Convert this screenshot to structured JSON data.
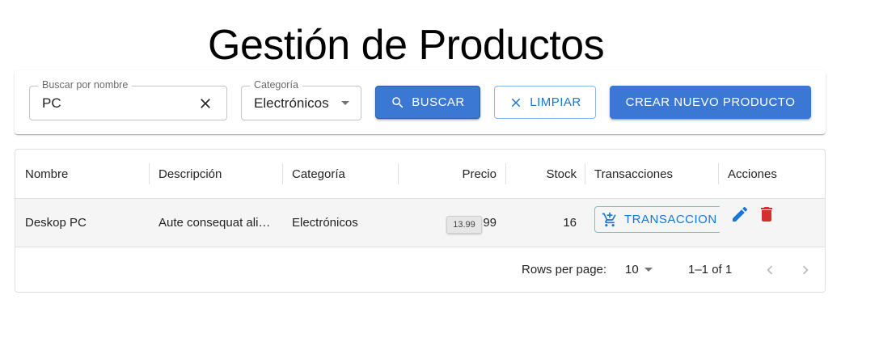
{
  "page": {
    "title": "Gestión de Productos"
  },
  "filters": {
    "search": {
      "label": "Buscar por nombre",
      "value": "PC"
    },
    "category": {
      "label": "Categoría",
      "value": "Electrónicos"
    },
    "search_button": "BUSCAR",
    "clear_button": "LIMPIAR",
    "create_button": "CREAR NUEVO PRODUCTO"
  },
  "table": {
    "columns": [
      "Nombre",
      "Descripción",
      "Categoría",
      "Precio",
      "Stock",
      "Transacciones",
      "Acciones"
    ],
    "rows": [
      {
        "nombre": "Deskop PC",
        "descripcion": "Aute consequat ali…",
        "categoria": "Electrónicos",
        "precio": "99",
        "precio_tooltip": "13.99",
        "stock": "16",
        "transacciones_button": "TRANSACCION"
      }
    ],
    "footer": {
      "rows_per_page_label": "Rows per page:",
      "rows_per_page_value": "10",
      "range": "1–1 of 1"
    }
  },
  "colors": {
    "primary": "#1976d2",
    "button_fill": "#3b78d4",
    "delete": "#d32f2f",
    "row_bg": "#f5f5f5"
  }
}
